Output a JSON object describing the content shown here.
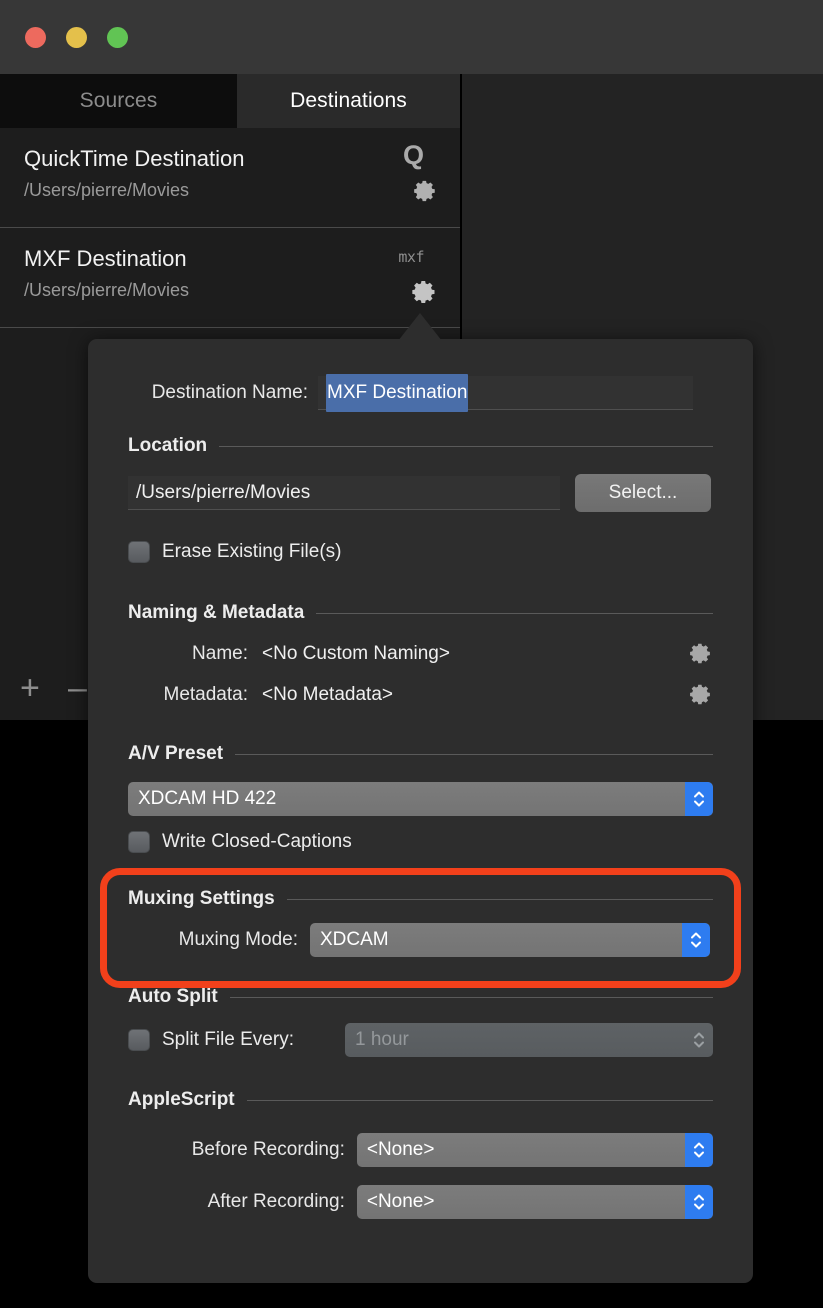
{
  "window": {
    "traffic_lights": [
      {
        "name": "close",
        "color": "#ed6a5e"
      },
      {
        "name": "minimize",
        "color": "#e4c04b"
      },
      {
        "name": "maximize",
        "color": "#61c454"
      }
    ]
  },
  "tabs": [
    {
      "label": "Sources",
      "selected": false
    },
    {
      "label": "Destinations",
      "selected": true
    }
  ],
  "destinations": [
    {
      "title": "QuickTime Destination",
      "path": "/Users/pierre/Movies",
      "badge": "Q",
      "badge_icon": "quicktime-icon",
      "gear_icon": "gear-icon"
    },
    {
      "title": "MXF Destination",
      "path": "/Users/pierre/Movies",
      "badge": "mxf",
      "badge_icon": "mxf-icon",
      "gear_icon": "gear-icon"
    }
  ],
  "list_footer": {
    "add_label": "+",
    "remove_label": "–"
  },
  "popover": {
    "destination_name": {
      "label": "Destination Name:",
      "value": "MXF Destination",
      "selected": true
    },
    "location": {
      "section": "Location",
      "path_value": "/Users/pierre/Movies",
      "select_button": "Select...",
      "erase_checkbox": {
        "label": "Erase Existing File(s)",
        "checked": false
      }
    },
    "naming_metadata": {
      "section": "Naming & Metadata",
      "name_label": "Name:",
      "name_value": "<No Custom Naming>",
      "name_gear_icon": "gear-icon",
      "metadata_label": "Metadata:",
      "metadata_value": "<No Metadata>",
      "metadata_gear_icon": "gear-icon"
    },
    "av_preset": {
      "section": "A/V Preset",
      "preset_value": "XDCAM HD 422",
      "cc_checkbox": {
        "label": "Write Closed-Captions",
        "checked": false
      }
    },
    "muxing_settings": {
      "section": "Muxing Settings",
      "mode_label": "Muxing Mode:",
      "mode_value": "XDCAM",
      "highlighted": true,
      "highlight_color": "#f2401b"
    },
    "auto_split": {
      "section": "Auto Split",
      "split_checkbox": {
        "label": "Split File Every:",
        "checked": false
      },
      "interval_value": "1 hour",
      "interval_disabled": true
    },
    "applescript": {
      "section": "AppleScript",
      "before_label": "Before Recording:",
      "before_value": "<None>",
      "after_label": "After Recording:",
      "after_value": "<None>"
    }
  }
}
